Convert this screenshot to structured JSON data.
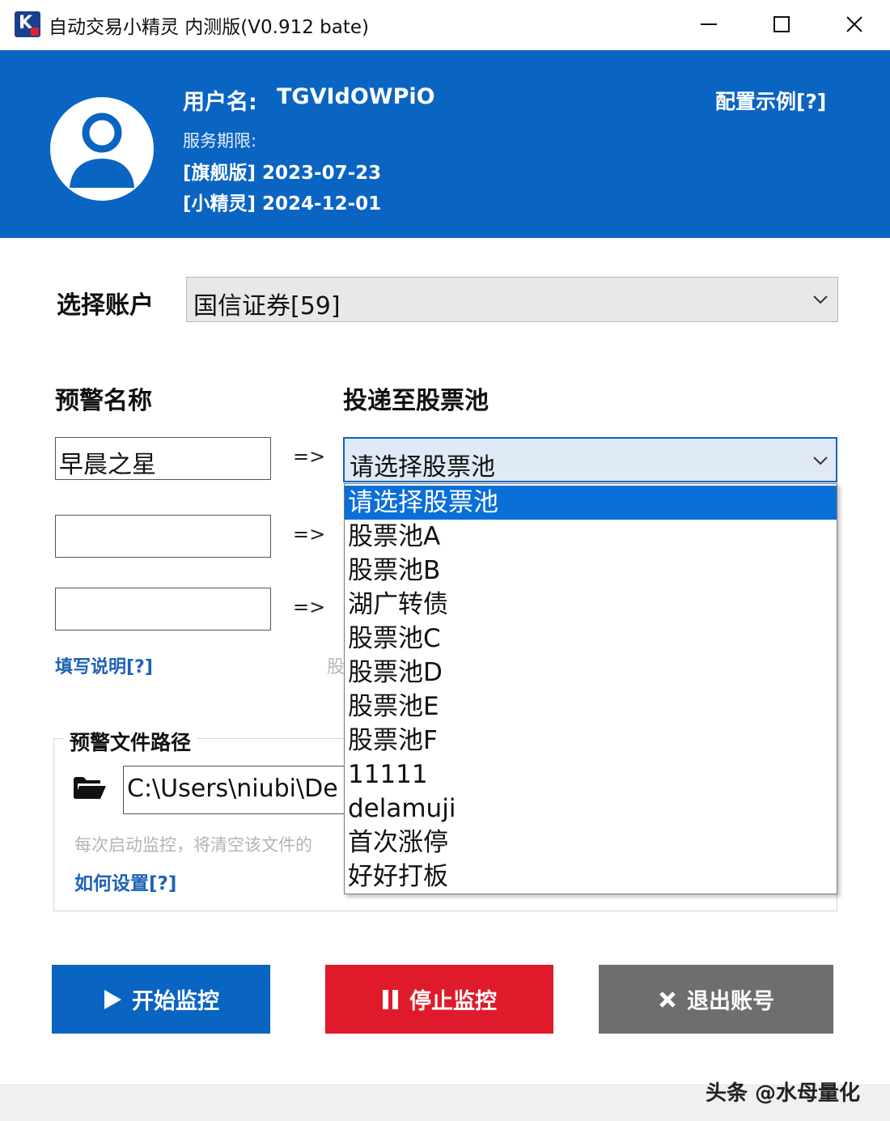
{
  "window": {
    "title": "自动交易小精灵 内测版(V0.912 bate)",
    "icon": "app-logo-icon"
  },
  "header": {
    "username_label": "用户名:",
    "username": "TGVIdOWPiO",
    "service_label": "服务期限:",
    "flagship_line": "[旗舰版] 2023-07-23",
    "sprite_line": "[小精灵] 2024-12-01",
    "config_link": "配置示例[?]",
    "background_color": "#0a64c2"
  },
  "account": {
    "label": "选择账户",
    "selected": "国信证券[59]"
  },
  "alerts": {
    "name_label": "预警名称",
    "pool_label": "投递至股票池",
    "arrow": "=>",
    "rows": [
      {
        "name": "早晨之星"
      },
      {
        "name": ""
      },
      {
        "name": ""
      }
    ]
  },
  "pool_select": {
    "selected": "请选择股票池",
    "options": [
      "请选择股票池",
      "股票池A",
      "股票池B",
      "湖广转债",
      "股票池C",
      "股票池D",
      "股票池E",
      "股票池F",
      "11111",
      "delamuji",
      "首次涨停",
      "好好打板"
    ],
    "highlighted_index": 0
  },
  "help": {
    "fill_link": "填写说明[?]",
    "pool_hint_fragment": "股"
  },
  "path_group": {
    "legend": "预警文件路径",
    "path_value": "C:\\Users\\niubi\\De",
    "note": "每次启动监控，将清空该文件的",
    "howto_link": "如何设置[?]"
  },
  "buttons": {
    "start": "开始监控",
    "stop": "停止监控",
    "logout": "退出账号",
    "start_color": "#0a64c2",
    "stop_color": "#df1b2b",
    "logout_color": "#6e6e6e"
  },
  "watermark": "头条 @水母量化"
}
